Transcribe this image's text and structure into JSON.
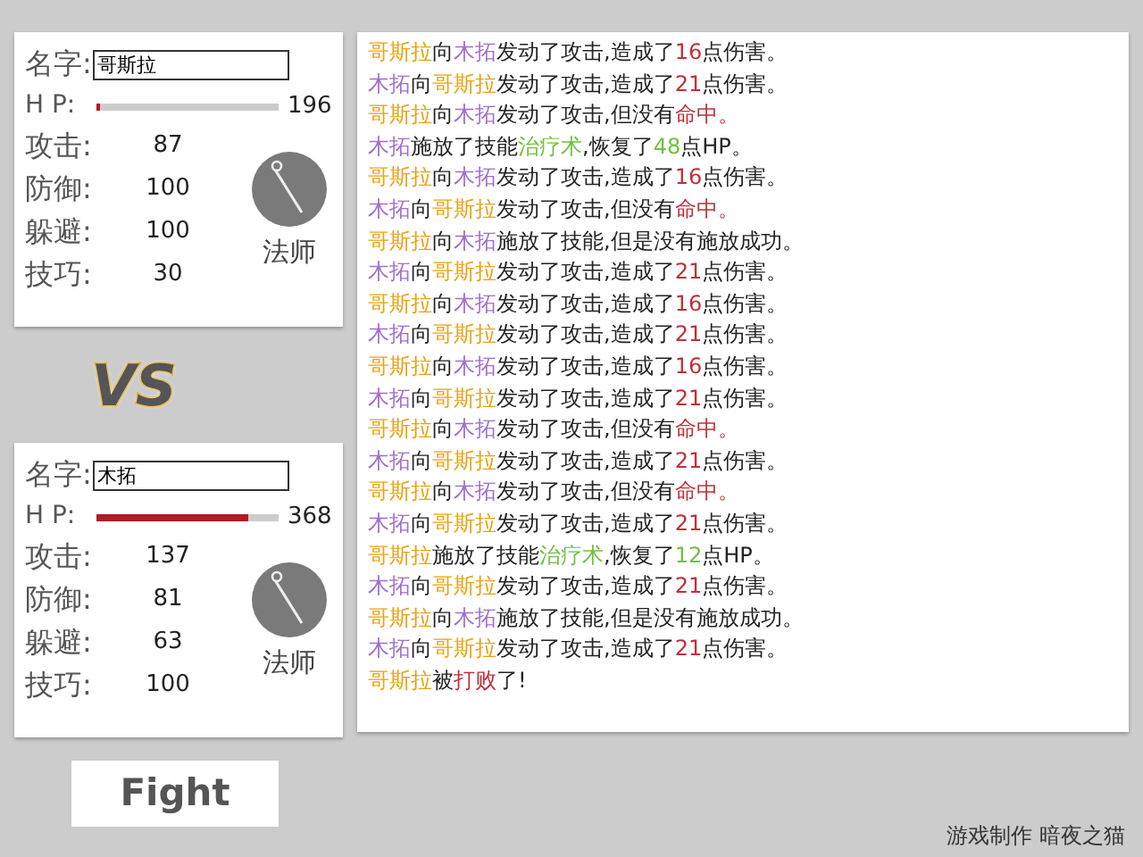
{
  "fighters": [
    {
      "name_label": "名字:",
      "name": "哥斯拉",
      "hp_label": "H P:",
      "hp": {
        "level": 0.02,
        "reading": "196"
      },
      "stats": [
        {
          "label": "攻击:",
          "value": "87"
        },
        {
          "label": "防御:",
          "value": "100"
        },
        {
          "label": "躲避:",
          "value": "100"
        },
        {
          "label": "技巧:",
          "value": "30"
        }
      ],
      "class_name": "法师"
    },
    {
      "name_label": "名字:",
      "name": "木拓",
      "hp_label": "H P:",
      "hp": {
        "level": 0.83,
        "reading": "368"
      },
      "stats": [
        {
          "label": "攻击:",
          "value": "137"
        },
        {
          "label": "防御:",
          "value": "81"
        },
        {
          "label": "躲避:",
          "value": "63"
        },
        {
          "label": "技巧:",
          "value": "100"
        }
      ],
      "class_name": "法师"
    }
  ],
  "vs_label": "VS",
  "log": [
    [
      {
        "text": "哥斯拉",
        "color": "#e8a317"
      },
      {
        "text": "向"
      },
      {
        "text": "木拓",
        "color": "#a070d0"
      },
      {
        "text": "发动了攻击,造成了"
      },
      {
        "text": "16",
        "color": "#c0303a"
      },
      {
        "text": "点伤害。"
      }
    ],
    [
      {
        "text": "木拓",
        "color": "#a070d0"
      },
      {
        "text": "向"
      },
      {
        "text": "哥斯拉",
        "color": "#e8a317"
      },
      {
        "text": "发动了攻击,造成了"
      },
      {
        "text": "21",
        "color": "#c0303a"
      },
      {
        "text": "点伤害。"
      }
    ],
    [
      {
        "text": "哥斯拉",
        "color": "#e8a317"
      },
      {
        "text": "向"
      },
      {
        "text": "木拓",
        "color": "#a070d0"
      },
      {
        "text": "发动了攻击,但没有"
      },
      {
        "text": "命中。",
        "color": "#c0303a"
      }
    ],
    [
      {
        "text": "木拓",
        "color": "#a070d0"
      },
      {
        "text": "施放了技能"
      },
      {
        "text": "治疗术",
        "color": "#70c040"
      },
      {
        "text": ",恢复了"
      },
      {
        "text": "48",
        "color": "#70c040"
      },
      {
        "text": "点HP。"
      }
    ],
    [
      {
        "text": "哥斯拉",
        "color": "#e8a317"
      },
      {
        "text": "向"
      },
      {
        "text": "木拓",
        "color": "#a070d0"
      },
      {
        "text": "发动了攻击,造成了"
      },
      {
        "text": "16",
        "color": "#c0303a"
      },
      {
        "text": "点伤害。"
      }
    ],
    [
      {
        "text": "木拓",
        "color": "#a070d0"
      },
      {
        "text": "向"
      },
      {
        "text": "哥斯拉",
        "color": "#e8a317"
      },
      {
        "text": "发动了攻击,但没有"
      },
      {
        "text": "命中。",
        "color": "#c0303a"
      }
    ],
    [
      {
        "text": "哥斯拉",
        "color": "#e8a317"
      },
      {
        "text": "向"
      },
      {
        "text": "木拓",
        "color": "#a070d0"
      },
      {
        "text": "施放了技能,但是没有施放成功。"
      }
    ],
    [
      {
        "text": "木拓",
        "color": "#a070d0"
      },
      {
        "text": "向"
      },
      {
        "text": "哥斯拉",
        "color": "#e8a317"
      },
      {
        "text": "发动了攻击,造成了"
      },
      {
        "text": "21",
        "color": "#c0303a"
      },
      {
        "text": "点伤害。"
      }
    ],
    [
      {
        "text": "哥斯拉",
        "color": "#e8a317"
      },
      {
        "text": "向"
      },
      {
        "text": "木拓",
        "color": "#a070d0"
      },
      {
        "text": "发动了攻击,造成了"
      },
      {
        "text": "16",
        "color": "#c0303a"
      },
      {
        "text": "点伤害。"
      }
    ],
    [
      {
        "text": "木拓",
        "color": "#a070d0"
      },
      {
        "text": "向"
      },
      {
        "text": "哥斯拉",
        "color": "#e8a317"
      },
      {
        "text": "发动了攻击,造成了"
      },
      {
        "text": "21",
        "color": "#c0303a"
      },
      {
        "text": "点伤害。"
      }
    ],
    [
      {
        "text": "哥斯拉",
        "color": "#e8a317"
      },
      {
        "text": "向"
      },
      {
        "text": "木拓",
        "color": "#a070d0"
      },
      {
        "text": "发动了攻击,造成了"
      },
      {
        "text": "16",
        "color": "#c0303a"
      },
      {
        "text": "点伤害。"
      }
    ],
    [
      {
        "text": "木拓",
        "color": "#a070d0"
      },
      {
        "text": "向"
      },
      {
        "text": "哥斯拉",
        "color": "#e8a317"
      },
      {
        "text": "发动了攻击,造成了"
      },
      {
        "text": "21",
        "color": "#c0303a"
      },
      {
        "text": "点伤害。"
      }
    ],
    [
      {
        "text": "哥斯拉",
        "color": "#e8a317"
      },
      {
        "text": "向"
      },
      {
        "text": "木拓",
        "color": "#a070d0"
      },
      {
        "text": "发动了攻击,但没有"
      },
      {
        "text": "命中。",
        "color": "#c0303a"
      }
    ],
    [
      {
        "text": "木拓",
        "color": "#a070d0"
      },
      {
        "text": "向"
      },
      {
        "text": "哥斯拉",
        "color": "#e8a317"
      },
      {
        "text": "发动了攻击,造成了"
      },
      {
        "text": "21",
        "color": "#c0303a"
      },
      {
        "text": "点伤害。"
      }
    ],
    [
      {
        "text": "哥斯拉",
        "color": "#e8a317"
      },
      {
        "text": "向"
      },
      {
        "text": "木拓",
        "color": "#a070d0"
      },
      {
        "text": "发动了攻击,但没有"
      },
      {
        "text": "命中。",
        "color": "#c0303a"
      }
    ],
    [
      {
        "text": "木拓",
        "color": "#a070d0"
      },
      {
        "text": "向"
      },
      {
        "text": "哥斯拉",
        "color": "#e8a317"
      },
      {
        "text": "发动了攻击,造成了"
      },
      {
        "text": "21",
        "color": "#c0303a"
      },
      {
        "text": "点伤害。"
      }
    ],
    [
      {
        "text": "哥斯拉",
        "color": "#e8a317"
      },
      {
        "text": "施放了技能"
      },
      {
        "text": "治疗术",
        "color": "#70c040"
      },
      {
        "text": ",恢复了"
      },
      {
        "text": "12",
        "color": "#70c040"
      },
      {
        "text": "点HP。"
      }
    ],
    [
      {
        "text": "木拓",
        "color": "#a070d0"
      },
      {
        "text": "向"
      },
      {
        "text": "哥斯拉",
        "color": "#e8a317"
      },
      {
        "text": "发动了攻击,造成了"
      },
      {
        "text": "21",
        "color": "#c0303a"
      },
      {
        "text": "点伤害。"
      }
    ],
    [
      {
        "text": "哥斯拉",
        "color": "#e8a317"
      },
      {
        "text": "向"
      },
      {
        "text": "木拓",
        "color": "#a070d0"
      },
      {
        "text": "施放了技能,但是没有施放成功。"
      }
    ],
    [
      {
        "text": "木拓",
        "color": "#a070d0"
      },
      {
        "text": "向"
      },
      {
        "text": "哥斯拉",
        "color": "#e8a317"
      },
      {
        "text": "发动了攻击,造成了"
      },
      {
        "text": "21",
        "color": "#c0303a"
      },
      {
        "text": "点伤害。"
      }
    ],
    [
      {
        "text": "哥斯拉",
        "color": "#e8a317"
      },
      {
        "text": "被"
      },
      {
        "text": "打败",
        "color": "#c0303a"
      },
      {
        "text": "了!"
      }
    ]
  ],
  "fight_button": "Fight",
  "credit": "游戏制作 暗夜之猫"
}
